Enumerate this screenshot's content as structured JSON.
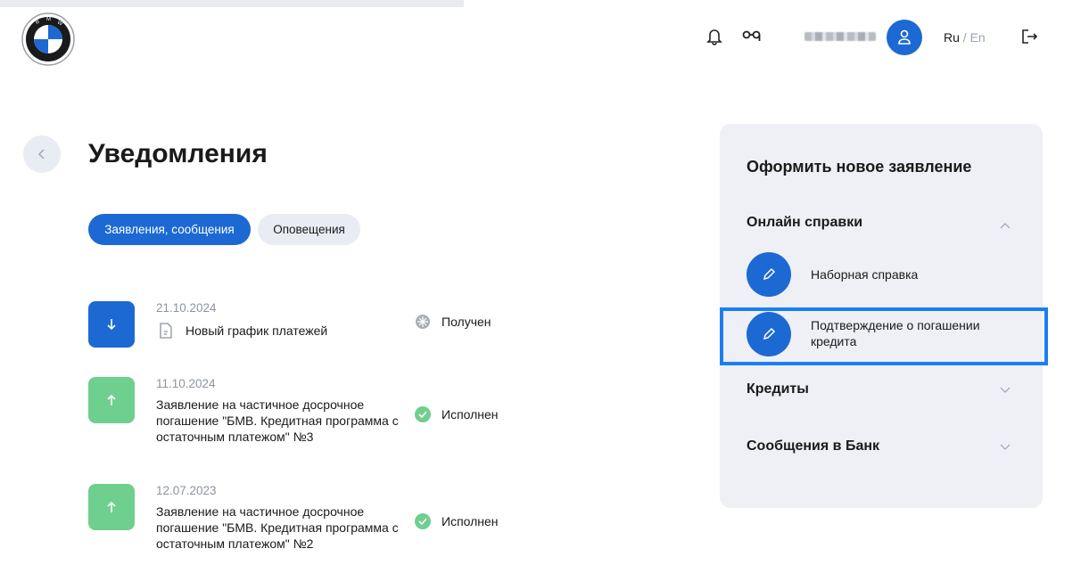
{
  "header": {
    "lang_ru": "Ru",
    "lang_sep": " / ",
    "lang_en": "En"
  },
  "main": {
    "title": "Уведомления",
    "tabs": [
      {
        "label": "Заявления, сообщения",
        "active": true
      },
      {
        "label": "Оповещения",
        "active": false
      }
    ],
    "notifications": [
      {
        "direction": "down",
        "color": "#1c69d4",
        "date": "21.10.2024",
        "title": "Новый график платежей",
        "status": "Получен",
        "status_icon": "received-icon"
      },
      {
        "direction": "up",
        "color": "#6fcf8e",
        "date": "11.10.2024",
        "title": "Заявление на частичное досрочное погашение \"БМВ. Кредитная программа с остаточным платежом\" №3",
        "status": "Исполнен",
        "status_icon": "check-icon"
      },
      {
        "direction": "up",
        "color": "#6fcf8e",
        "date": "12.07.2023",
        "title": "Заявление на частичное досрочное погашение \"БМВ. Кредитная программа с остаточным платежом\" №2",
        "status": "Исполнен",
        "status_icon": "check-icon"
      }
    ]
  },
  "panel": {
    "title": "Оформить новое заявление",
    "sections": [
      {
        "label": "Онлайн справки",
        "expanded": true,
        "items": [
          {
            "label": "Наборная справка"
          },
          {
            "label": "Подтверждение о погашении кредита",
            "highlighted": true
          }
        ]
      },
      {
        "label": "Кредиты",
        "expanded": false
      },
      {
        "label": "Сообщения в Банк",
        "expanded": false
      }
    ]
  },
  "colors": {
    "accent": "#1c69d4",
    "success": "#6fcf8e",
    "panel_bg": "#eef0f5",
    "highlight": "#1a7ff5"
  }
}
